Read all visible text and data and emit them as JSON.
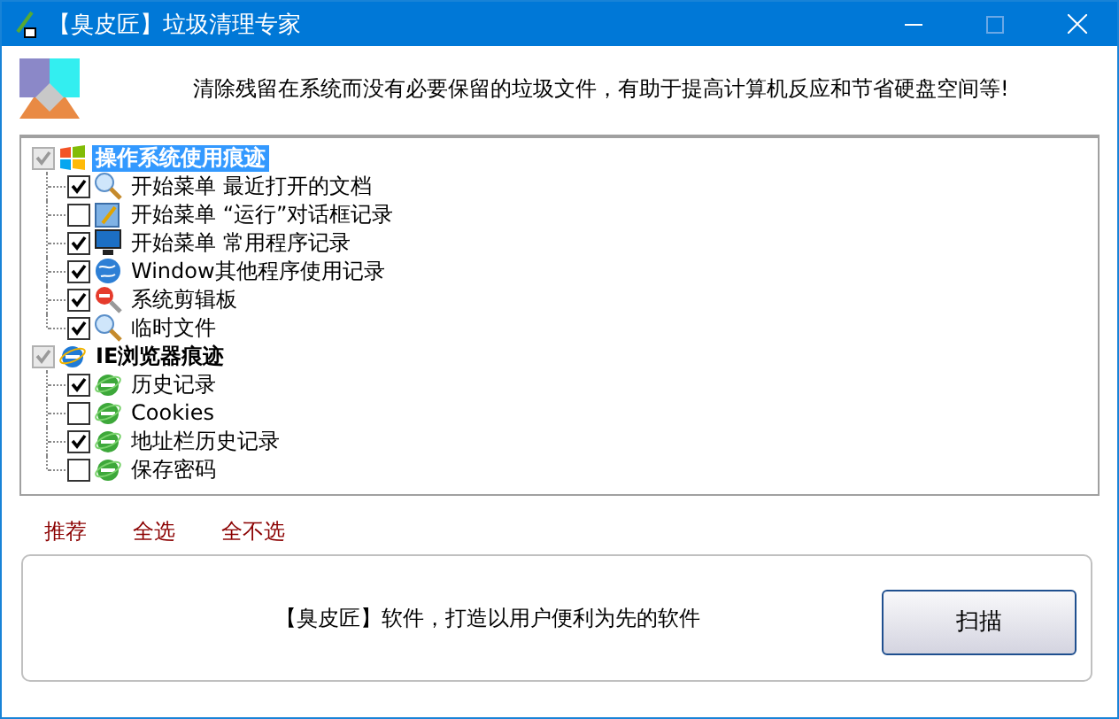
{
  "window": {
    "title": "【臭皮匠】垃圾清理专家"
  },
  "header": {
    "message": "清除残留在系统而没有必要保留的垃圾文件，有助于提高计算机反应和节省硬盘空间等!"
  },
  "tree": [
    {
      "label": "操作系统使用痕迹",
      "checked": true,
      "selected": true,
      "kind": "windows",
      "children": [
        {
          "label": "开始菜单 最近打开的文档",
          "checked": true,
          "kind": "search"
        },
        {
          "label": "开始菜单 “运行”对话框记录",
          "checked": false,
          "kind": "run"
        },
        {
          "label": "开始菜单 常用程序记录",
          "checked": true,
          "kind": "monitor"
        },
        {
          "label": "Window其他程序使用记录",
          "checked": true,
          "kind": "globe"
        },
        {
          "label": "系统剪辑板",
          "checked": true,
          "kind": "clip"
        },
        {
          "label": "临时文件",
          "checked": true,
          "kind": "search"
        }
      ]
    },
    {
      "label": "IE浏览器痕迹",
      "checked": true,
      "selected": false,
      "kind": "ie",
      "children": [
        {
          "label": "历史记录",
          "checked": true,
          "kind": "ie-green"
        },
        {
          "label": "Cookies",
          "checked": false,
          "kind": "ie-green"
        },
        {
          "label": "地址栏历史记录",
          "checked": true,
          "kind": "ie-green"
        },
        {
          "label": "保存密码",
          "checked": false,
          "kind": "ie-green"
        }
      ]
    }
  ],
  "links": [
    "推荐",
    "全选",
    "全不选"
  ],
  "footer": {
    "slogan": "【臭皮匠】软件，打造以用户便利为先的软件",
    "button": "扫描"
  }
}
